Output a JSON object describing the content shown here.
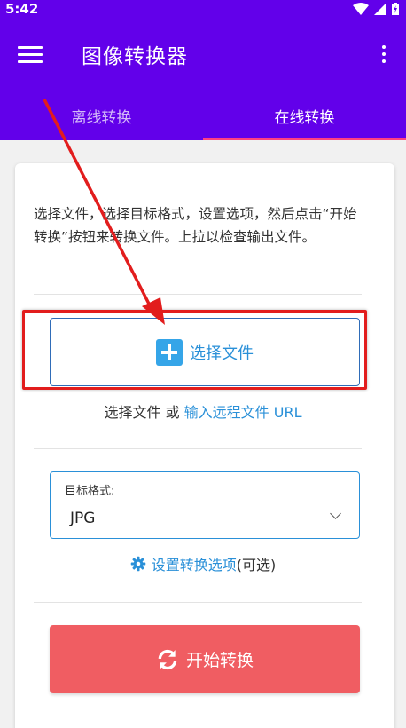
{
  "status_bar": {
    "time": "5:42"
  },
  "app_bar": {
    "title": "图像转换器"
  },
  "tabs": [
    {
      "label": "离线转换",
      "active": false
    },
    {
      "label": "在线转换",
      "active": true
    }
  ],
  "instructions": "选择文件，选择目标格式，设置选项，然后点击“开始转换”按钮来转换文件。上拉以检查输出文件。",
  "select_file": {
    "button_label": "选择文件",
    "alt_prefix": "选择文件 或 ",
    "alt_link": "输入远程文件 URL"
  },
  "target_format": {
    "label": "目标格式:",
    "value": "JPG"
  },
  "options": {
    "link": "设置转换选项",
    "suffix": " (可选)"
  },
  "start_button": {
    "label": "开始转换"
  },
  "colors": {
    "app_bar": "#6200ea",
    "tab_indicator": "#ff4081",
    "link": "#2a90d8",
    "start_button": "#f05d62",
    "annotation": "#e21d1d"
  }
}
